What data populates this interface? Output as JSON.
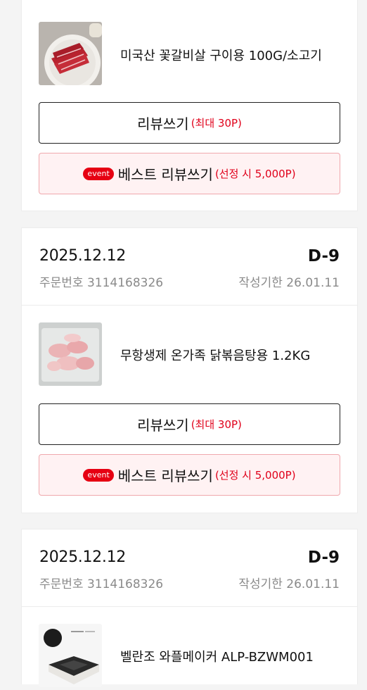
{
  "orders": [
    {
      "product_name": "미국산 꽃갈비살 구이용 100G/소고기",
      "thumb_icon": "beef-meat-photo",
      "review_button": {
        "label": "리뷰쓰기",
        "points": "(최대 30P)"
      },
      "best_button": {
        "badge": "event",
        "label": "베스트 리뷰쓰기",
        "points": "(선정 시 5,000P)"
      }
    },
    {
      "date": "2025.12.12",
      "dday": "D-9",
      "order_number": "주문번호 3114168326",
      "deadline": "작성기한 26.01.11",
      "product_name": "무항생제 온가족 닭볶음탕용 1.2KG",
      "thumb_icon": "raw-chicken-photo",
      "review_button": {
        "label": "리뷰쓰기",
        "points": "(최대 30P)"
      },
      "best_button": {
        "badge": "event",
        "label": "베스트 리뷰쓰기",
        "points": "(선정 시 5,000P)"
      }
    },
    {
      "date": "2025.12.12",
      "dday": "D-9",
      "order_number": "주문번호 3114168326",
      "deadline": "작성기한 26.01.11",
      "product_name": "벨란조 와플메이커 ALP-BZWM001",
      "thumb_icon": "waffle-maker-photo"
    }
  ],
  "colors": {
    "accent_red": "#e0001a",
    "best_bg": "#fff2f3",
    "best_border": "#f0a8ad"
  }
}
